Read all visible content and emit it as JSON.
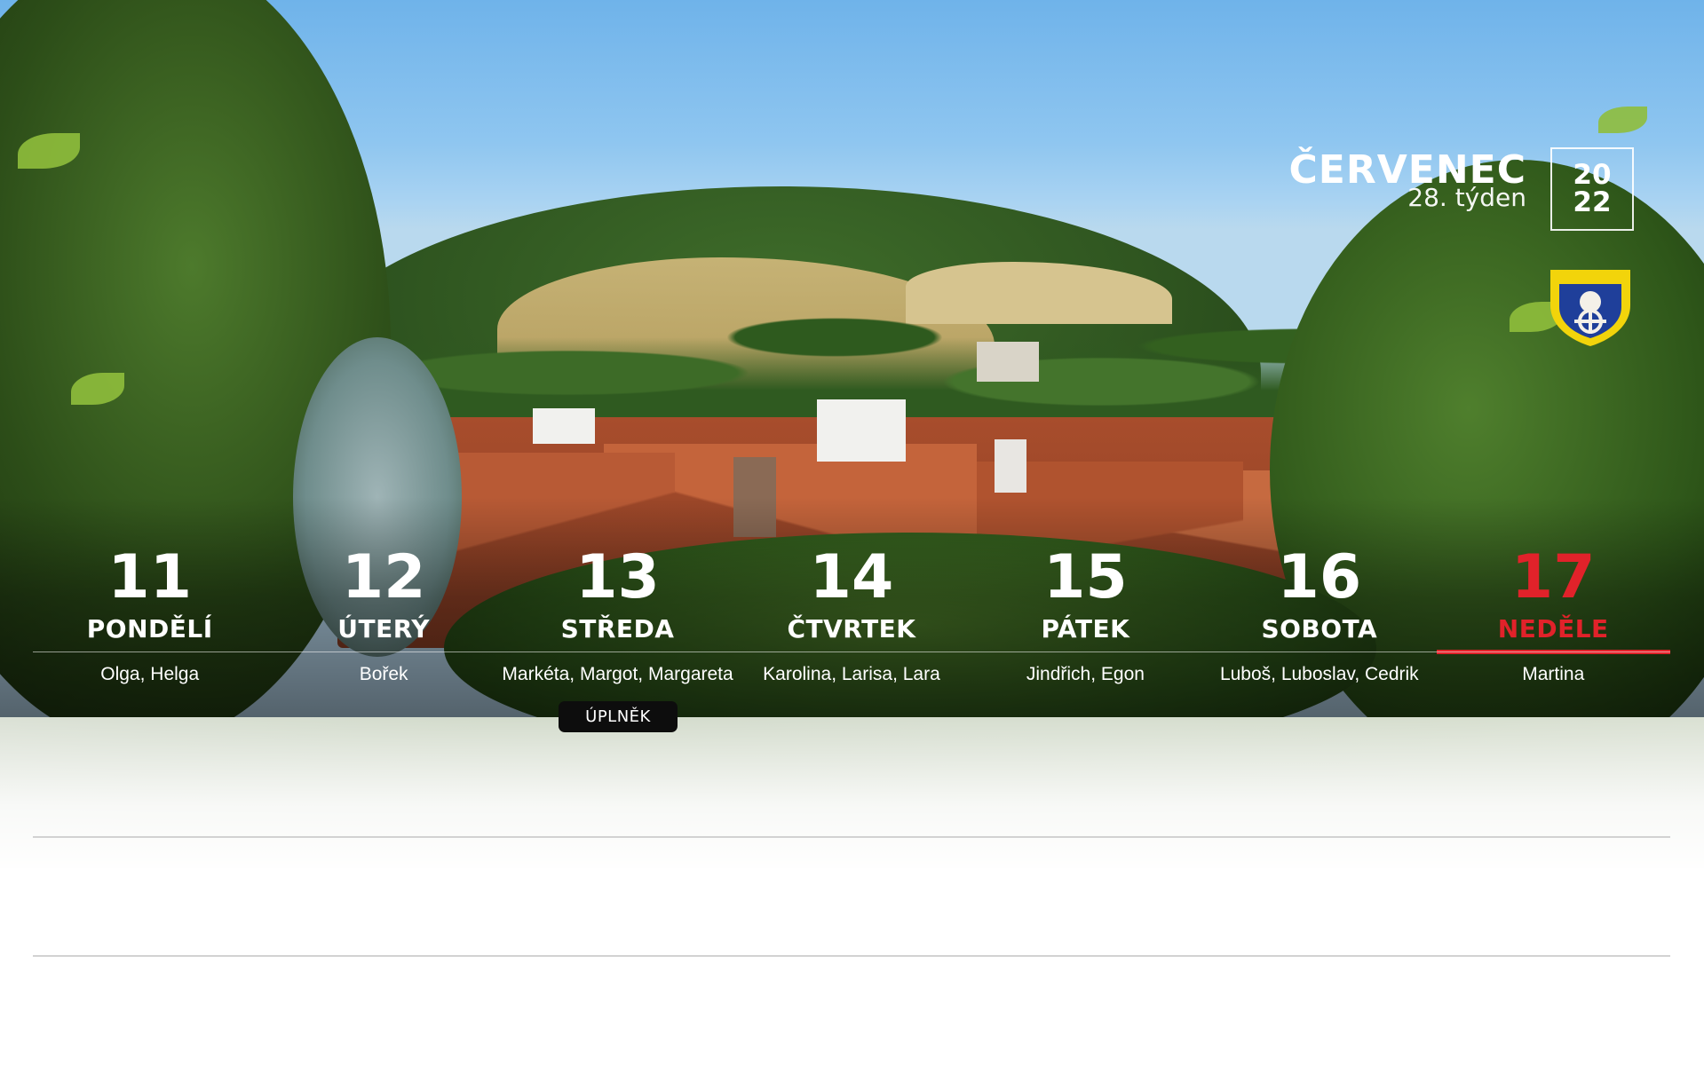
{
  "header": {
    "month": "ČERVENEC",
    "week": "28. týden",
    "year_top": "20",
    "year_bottom": "22"
  },
  "crest_icon": "municipal-coat-of-arms",
  "colors": {
    "sunday_accent": "#e1222a",
    "moon_badge_bg": "#0d0d0d"
  },
  "days": [
    {
      "number": "11",
      "name": "PONDĚLÍ",
      "nameday": "Olga, Helga"
    },
    {
      "number": "12",
      "name": "ÚTERÝ",
      "nameday": "Bořek"
    },
    {
      "number": "13",
      "name": "STŘEDA",
      "nameday": "Markéta, Margot, Margareta"
    },
    {
      "number": "14",
      "name": "ČTVRTEK",
      "nameday": "Karolina, Larisa, Lara"
    },
    {
      "number": "15",
      "name": "PÁTEK",
      "nameday": "Jindřich, Egon"
    },
    {
      "number": "16",
      "name": "SOBOTA",
      "nameday": "Luboš, Luboslav, Cedrik"
    },
    {
      "number": "17",
      "name": "NEDĚLE",
      "nameday": "Martina"
    }
  ],
  "moon_phase": "ÚPLNĚK"
}
